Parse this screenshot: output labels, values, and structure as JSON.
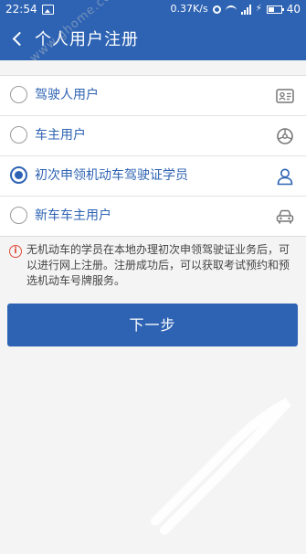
{
  "status_bar": {
    "time": "22:54",
    "speed": "0.37",
    "speed_unit": "K/s",
    "battery": "40"
  },
  "header": {
    "title": "个人用户注册"
  },
  "options": [
    {
      "label": "驾驶人用户",
      "icon": "id-card-icon",
      "checked": false
    },
    {
      "label": "车主用户",
      "icon": "steering-wheel-icon",
      "checked": false
    },
    {
      "label": "初次申领机动车驾驶证学员",
      "icon": "person-icon",
      "checked": true
    },
    {
      "label": "新车车主用户",
      "icon": "car-icon",
      "checked": false
    }
  ],
  "notice": {
    "text": "无机动车的学员在本地办理初次申领驾驶证业务后，可以进行网上注册。注册成功后，可以获取考试预约和预选机动车号牌服务。"
  },
  "next_button": {
    "label": "下一步"
  },
  "watermark": {
    "text": "www.ghome.com"
  },
  "colors": {
    "primary": "#2e63b3",
    "notice_icon": "#e04d38"
  }
}
